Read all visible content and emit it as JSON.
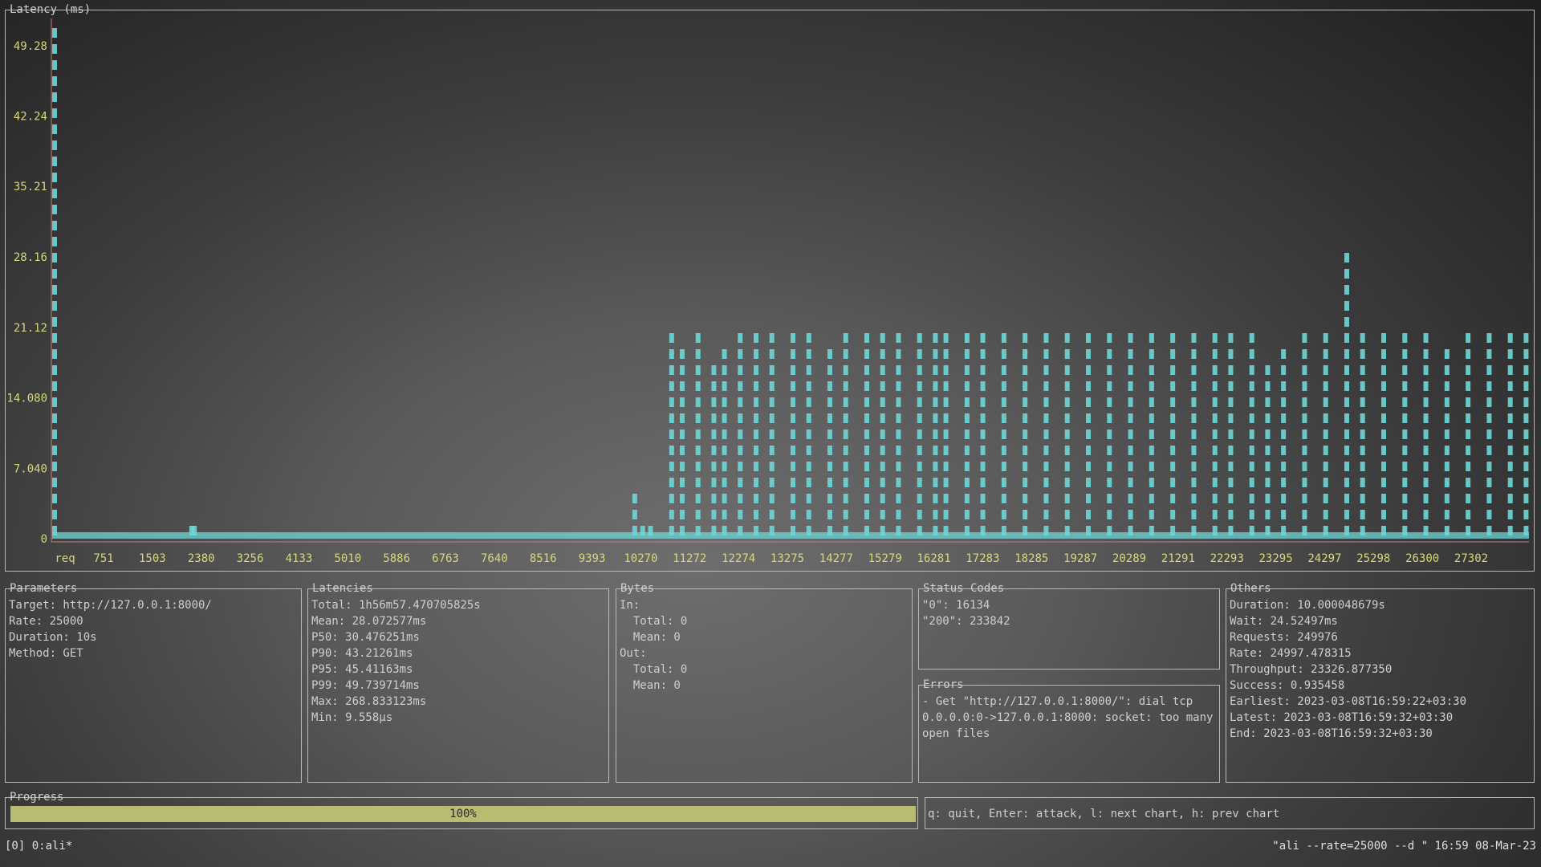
{
  "latency_chart": {
    "title": "Latency (ms)",
    "x_title": "req"
  },
  "chart_data": {
    "type": "bar",
    "title": "Latency (ms)",
    "xlabel": "req",
    "ylabel": "",
    "y_ticks": [
      "0",
      "7.040",
      "14.080",
      "21.12",
      "28.16",
      "35.21",
      "42.24",
      "49.28"
    ],
    "x_ticks": [
      "751",
      "1503",
      "2380",
      "3256",
      "4133",
      "5010",
      "5886",
      "6763",
      "7640",
      "8516",
      "9393",
      "10270",
      "11272",
      "12274",
      "13275",
      "14277",
      "15279",
      "16281",
      "17283",
      "18285",
      "19287",
      "20289",
      "21291",
      "22293",
      "23295",
      "24297",
      "25298",
      "26300",
      "27302"
    ],
    "ylim": [
      0,
      52
    ],
    "xlim": [
      0,
      28000
    ],
    "series": [
      {
        "color": "#6fd6d6",
        "points": [
          [
            0,
            52
          ],
          [
            2600,
            3
          ],
          [
            2650,
            3
          ],
          [
            11000,
            6
          ],
          [
            11150,
            3
          ],
          [
            11300,
            2
          ],
          [
            11700,
            21
          ],
          [
            11900,
            20
          ],
          [
            12200,
            21
          ],
          [
            12500,
            18
          ],
          [
            12700,
            20
          ],
          [
            13000,
            21
          ],
          [
            13300,
            21
          ],
          [
            13600,
            21
          ],
          [
            14000,
            21
          ],
          [
            14300,
            21
          ],
          [
            14700,
            20
          ],
          [
            15000,
            21
          ],
          [
            15400,
            21
          ],
          [
            15700,
            21
          ],
          [
            16000,
            21
          ],
          [
            16400,
            21
          ],
          [
            16700,
            22
          ],
          [
            16900,
            22
          ],
          [
            17300,
            21
          ],
          [
            17600,
            21
          ],
          [
            18000,
            21
          ],
          [
            18400,
            21
          ],
          [
            18800,
            21
          ],
          [
            19200,
            21
          ],
          [
            19600,
            21
          ],
          [
            20000,
            21
          ],
          [
            20400,
            22
          ],
          [
            20800,
            21
          ],
          [
            21200,
            22
          ],
          [
            21600,
            21
          ],
          [
            22000,
            21
          ],
          [
            22300,
            22
          ],
          [
            22700,
            21
          ],
          [
            23000,
            18
          ],
          [
            23300,
            20
          ],
          [
            23700,
            21
          ],
          [
            24100,
            21
          ],
          [
            24500,
            29
          ],
          [
            24800,
            21
          ],
          [
            25200,
            21
          ],
          [
            25600,
            21
          ],
          [
            26000,
            21
          ],
          [
            26400,
            20
          ],
          [
            26800,
            21
          ],
          [
            27200,
            21
          ],
          [
            27600,
            21
          ],
          [
            27900,
            21
          ]
        ]
      }
    ]
  },
  "parameters": {
    "title": "Parameters",
    "lines": [
      "Target: http://127.0.0.1:8000/",
      "Rate: 25000",
      "Duration: 10s",
      "Method: GET"
    ]
  },
  "latencies": {
    "title": "Latencies",
    "lines": [
      "Total: 1h56m57.470705825s",
      "Mean: 28.072577ms",
      "P50: 30.476251ms",
      "P90: 43.21261ms",
      "P95: 45.41163ms",
      "P99: 49.739714ms",
      "Max: 268.833123ms",
      "Min: 9.558µs"
    ]
  },
  "bytes": {
    "title": "Bytes",
    "lines": [
      "In:",
      "  Total: 0",
      "  Mean: 0",
      "Out:",
      "  Total: 0",
      "  Mean: 0"
    ]
  },
  "status_codes": {
    "title": "Status Codes",
    "lines": [
      "\"0\": 16134",
      "\"200\": 233842"
    ]
  },
  "errors": {
    "title": "Errors",
    "lines": [
      "- Get \"http://127.0.0.1:8000/\": dial tcp",
      "0.0.0.0:0->127.0.0.1:8000: socket: too many",
      "open files"
    ]
  },
  "others": {
    "title": "Others",
    "lines": [
      "Duration: 10.000048679s",
      "Wait: 24.52497ms",
      "Requests: 249976",
      "Rate: 24997.478315",
      "Throughput: 23326.877350",
      "Success: 0.935458",
      "Earliest: 2023-03-08T16:59:22+03:30",
      "Latest: 2023-03-08T16:59:32+03:30",
      "End: 2023-03-08T16:59:32+03:30"
    ]
  },
  "progress": {
    "title": "Progress",
    "value": 1.0,
    "label": "100%"
  },
  "help": {
    "text": "q: quit, Enter: attack, l: next chart, h: prev chart"
  },
  "statusbar": {
    "left": "[0] 0:ali*",
    "right": "\"ali --rate=25000 --d \" 16:59 08-Mar-23"
  },
  "colors": {
    "bars": "#6fd6d6",
    "ticks": "#d8d87a",
    "axis": "#c87a7a",
    "progress": "#b7bc72"
  }
}
